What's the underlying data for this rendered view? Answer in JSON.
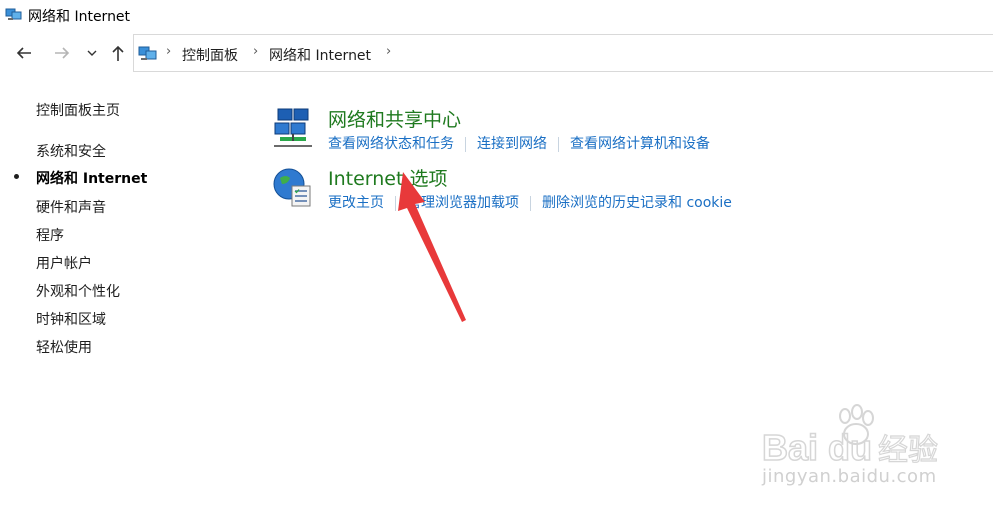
{
  "window": {
    "title": "网络和 Internet"
  },
  "addressbar": {
    "crumbs": [
      "控制面板",
      "网络和 Internet"
    ]
  },
  "sidebar": {
    "items": [
      {
        "label": "控制面板主页",
        "active": false
      },
      {
        "label": "系统和安全",
        "active": false
      },
      {
        "label": "网络和 Internet",
        "active": true
      },
      {
        "label": "硬件和声音",
        "active": false
      },
      {
        "label": "程序",
        "active": false
      },
      {
        "label": "用户帐户",
        "active": false
      },
      {
        "label": "外观和个性化",
        "active": false
      },
      {
        "label": "时钟和区域",
        "active": false
      },
      {
        "label": "轻松使用",
        "active": false
      }
    ]
  },
  "categories": [
    {
      "title": "网络和共享中心",
      "icon": "network-sharing-center-icon",
      "links": [
        "查看网络状态和任务",
        "连接到网络",
        "查看网络计算机和设备"
      ]
    },
    {
      "title": "Internet 选项",
      "icon": "internet-options-globe-icon",
      "links": [
        "更改主页",
        "管理浏览器加载项",
        "删除浏览的历史记录和 cookie"
      ]
    }
  ],
  "watermark": {
    "brand": "Baidu经验",
    "url": "jingyan.baidu.com"
  },
  "colors": {
    "link": "#1a6fc4",
    "category_title": "#1f7a1f",
    "annotation_arrow": "#e8393a"
  }
}
